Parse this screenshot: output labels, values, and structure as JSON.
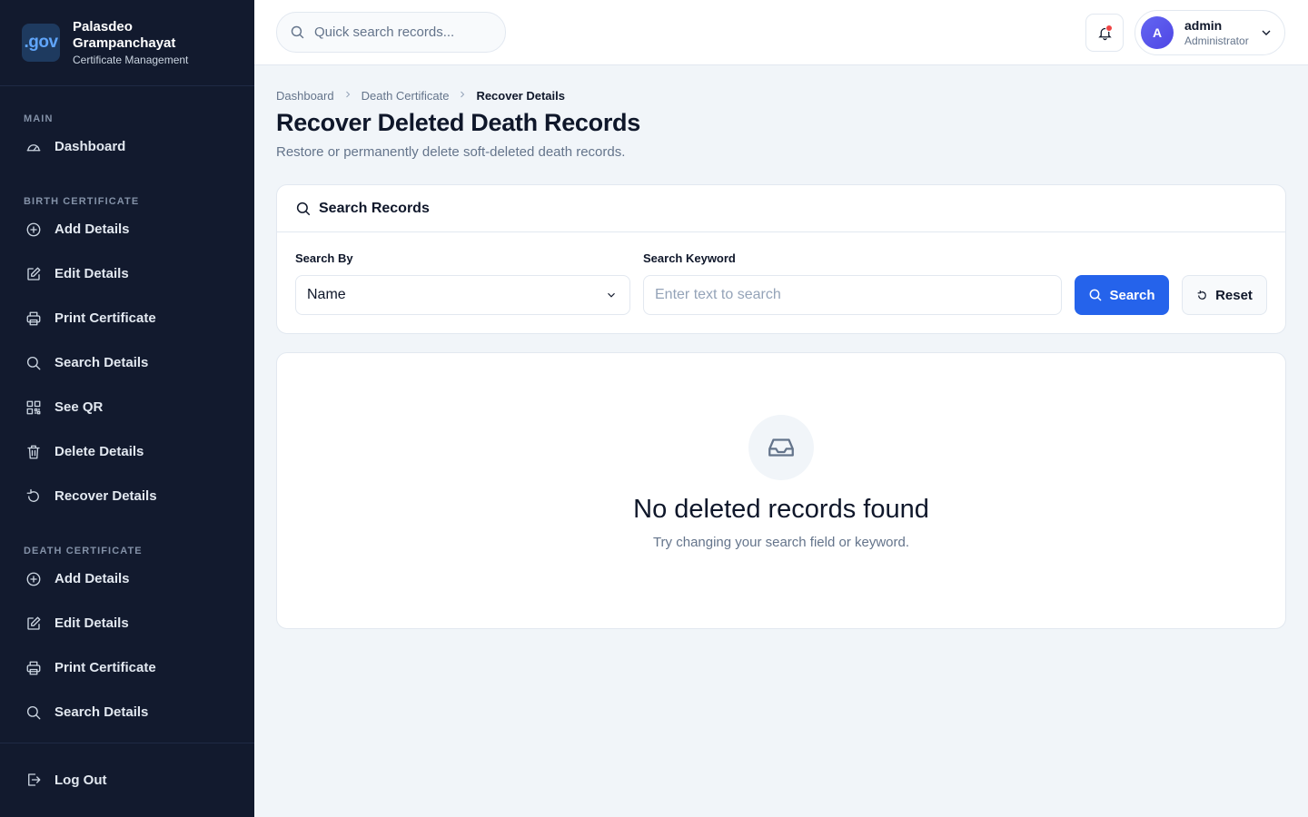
{
  "brand": {
    "logo_text": ".gov",
    "name_line1": "Palasdeo",
    "name_line2": "Grampanchayat",
    "subtitle": "Certificate Management"
  },
  "sidebar": {
    "sections": {
      "main": "MAIN",
      "birth": "BIRTH CERTIFICATE",
      "death": "DEATH CERTIFICATE"
    },
    "main_items": [
      {
        "label": "Dashboard",
        "icon": "dashboard-icon"
      }
    ],
    "birth_items": [
      {
        "label": "Add Details",
        "icon": "plus-circle-icon"
      },
      {
        "label": "Edit Details",
        "icon": "edit-icon"
      },
      {
        "label": "Print Certificate",
        "icon": "printer-icon"
      },
      {
        "label": "Search Details",
        "icon": "search-icon"
      },
      {
        "label": "See QR",
        "icon": "qr-code-icon"
      },
      {
        "label": "Delete Details",
        "icon": "trash-icon"
      },
      {
        "label": "Recover Details",
        "icon": "rotate-icon"
      }
    ],
    "death_items": [
      {
        "label": "Add Details",
        "icon": "plus-circle-icon"
      },
      {
        "label": "Edit Details",
        "icon": "edit-icon"
      },
      {
        "label": "Print Certificate",
        "icon": "printer-icon"
      },
      {
        "label": "Search Details",
        "icon": "search-icon"
      }
    ],
    "logout_label": "Log Out"
  },
  "topbar": {
    "quick_search_placeholder": "Quick search records...",
    "user_initial": "A",
    "user_name": "admin",
    "user_role": "Administrator"
  },
  "breadcrumb": [
    "Dashboard",
    "Death Certificate",
    "Recover Details"
  ],
  "page": {
    "title": "Recover Deleted Death Records",
    "subtitle": "Restore or permanently delete soft-deleted death records."
  },
  "search_card": {
    "title": "Search Records",
    "search_by_label": "Search By",
    "search_by_value": "Name",
    "keyword_label": "Search Keyword",
    "keyword_placeholder": "Enter text to search",
    "search_button": "Search",
    "reset_button": "Reset"
  },
  "empty_state": {
    "title": "No deleted records found",
    "subtitle": "Try changing your search field or keyword."
  },
  "colors": {
    "sidebar_bg": "#121a2e",
    "primary": "#2563eb",
    "notification_dot": "#ef4444",
    "avatar": "#4f46e5"
  }
}
